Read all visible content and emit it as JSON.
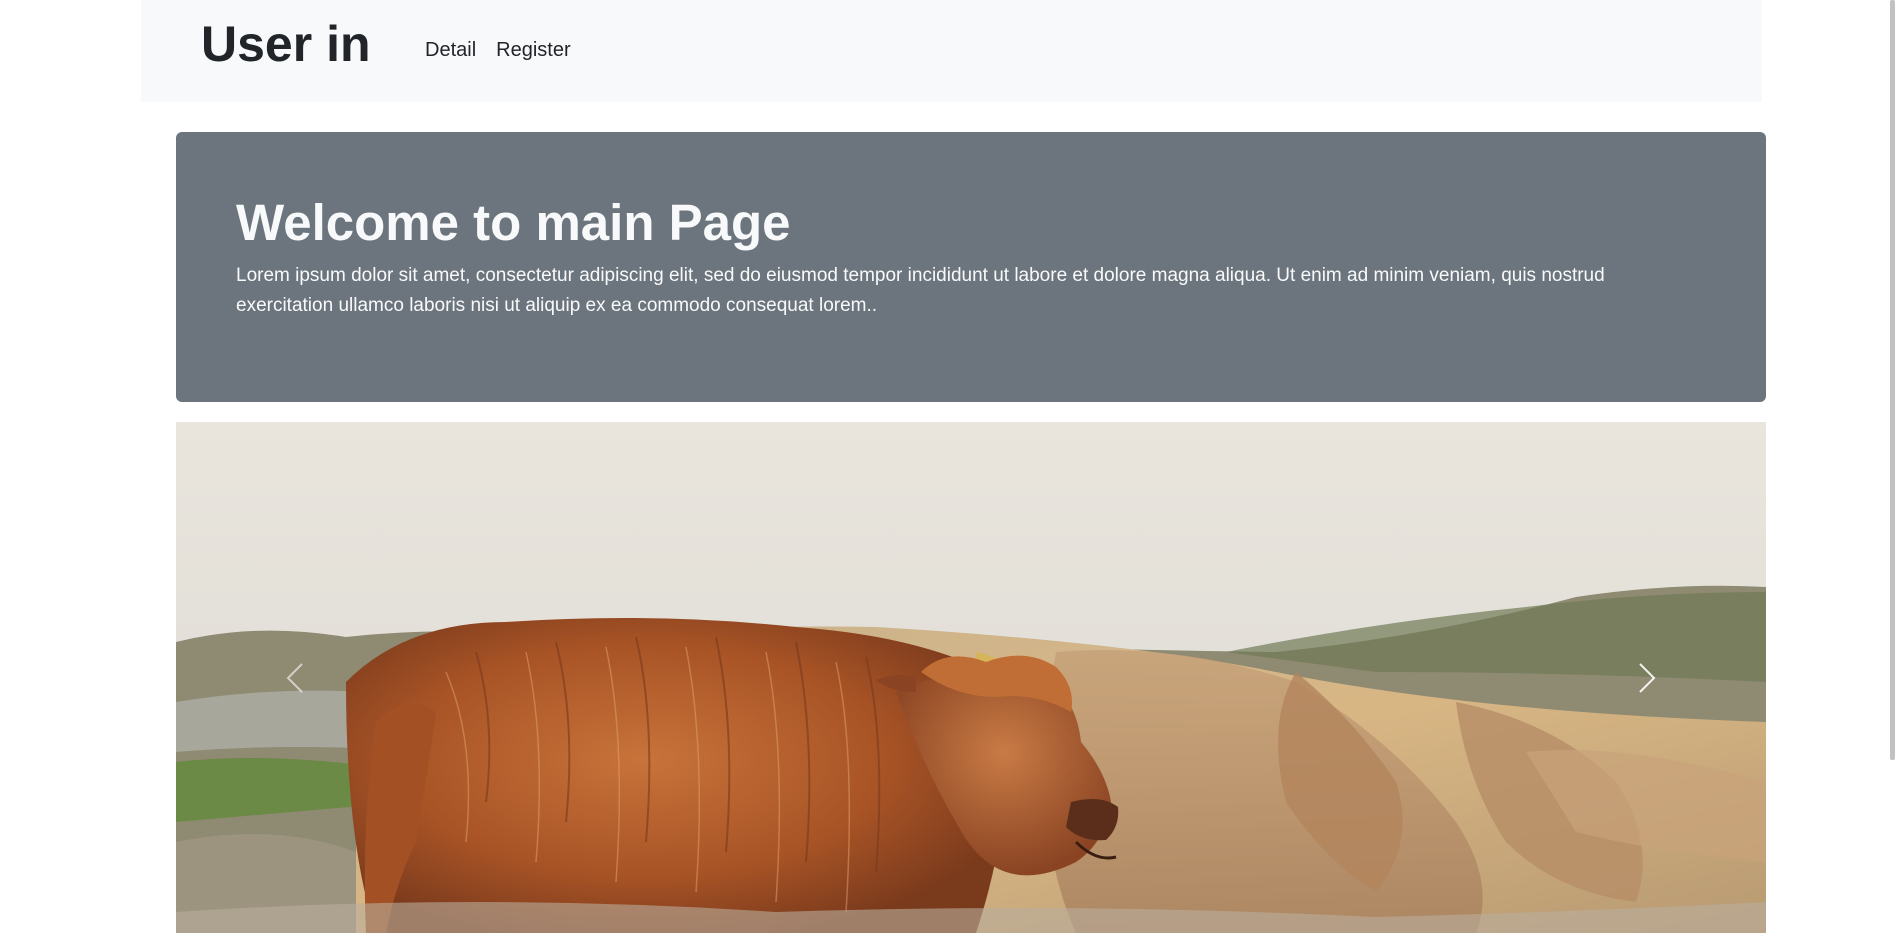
{
  "navbar": {
    "brand": "User in",
    "links": [
      {
        "label": "Detail"
      },
      {
        "label": "Register"
      }
    ]
  },
  "jumbotron": {
    "title": "Welcome to main Page",
    "text": "Lorem ipsum dolor sit amet, consectetur adipiscing elit, sed do eiusmod tempor incididunt ut labore et dolore magna aliqua. Ut enim ad minim veniam, quis nostrud exercitation ullamco laboris nisi ut aliquip ex ea commodo consequat lorem.."
  },
  "carousel": {
    "prev_icon": "chevron-left-icon",
    "next_icon": "chevron-right-icon",
    "image_subject": "highland-cow-photo"
  },
  "colors": {
    "navbar_bg": "#f8f9fa",
    "jumbotron_bg": "#6c757d",
    "jumbotron_text": "#f8f9fa"
  }
}
